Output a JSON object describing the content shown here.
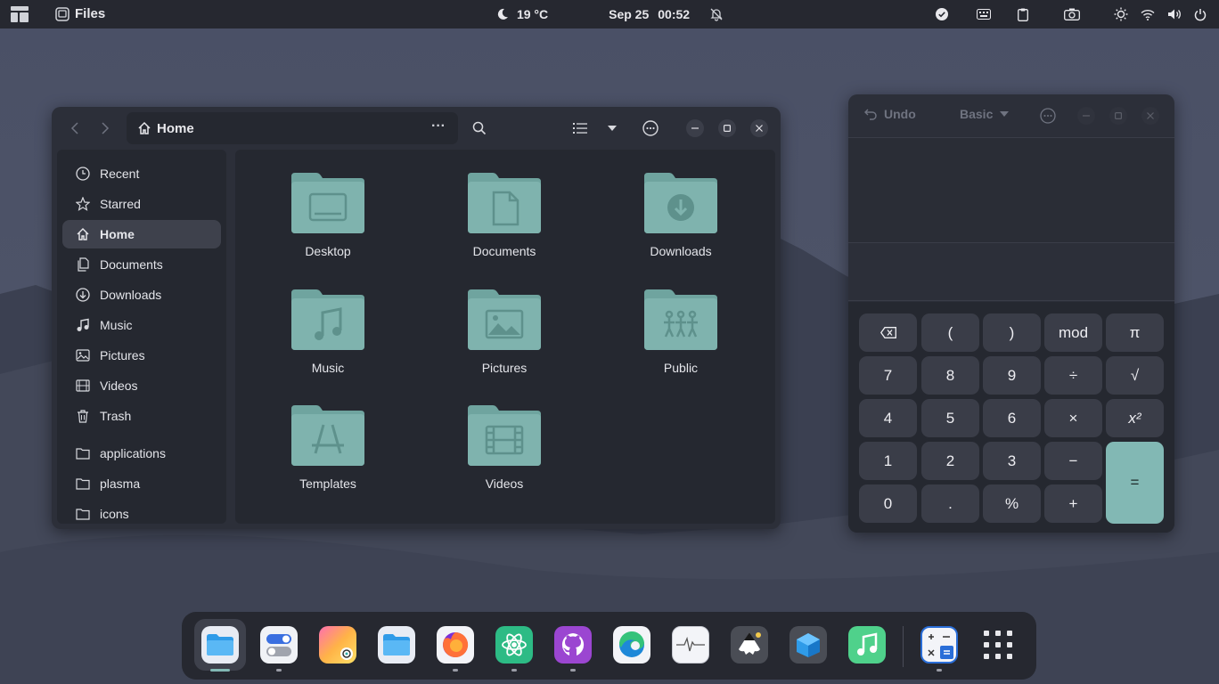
{
  "topbar": {
    "app_name": "Files",
    "weather": "19 °C",
    "date": "Sep 25",
    "time": "00:52"
  },
  "files": {
    "path": "Home",
    "sidebar": [
      {
        "label": "Recent",
        "icon": "clock-icon"
      },
      {
        "label": "Starred",
        "icon": "star-icon"
      },
      {
        "label": "Home",
        "icon": "home-icon",
        "active": true
      },
      {
        "label": "Documents",
        "icon": "documents-icon"
      },
      {
        "label": "Downloads",
        "icon": "download-icon"
      },
      {
        "label": "Music",
        "icon": "music-icon"
      },
      {
        "label": "Pictures",
        "icon": "pictures-icon"
      },
      {
        "label": "Videos",
        "icon": "videos-icon"
      },
      {
        "label": "Trash",
        "icon": "trash-icon"
      },
      {
        "label": "applications",
        "icon": "folder-icon"
      },
      {
        "label": "plasma",
        "icon": "folder-icon"
      },
      {
        "label": "icons",
        "icon": "folder-icon"
      }
    ],
    "folders": [
      "Desktop",
      "Documents",
      "Downloads",
      "Music",
      "Pictures",
      "Public",
      "Templates",
      "Videos"
    ]
  },
  "calculator": {
    "undo": "Undo",
    "mode": "Basic",
    "keys": {
      "lparen": "(",
      "rparen": ")",
      "mod": "mod",
      "pi": "π",
      "k7": "7",
      "k8": "8",
      "k9": "9",
      "div": "÷",
      "sqrt": "√",
      "k4": "4",
      "k5": "5",
      "k6": "6",
      "mul": "×",
      "sq": "x²",
      "k1": "1",
      "k2": "2",
      "k3": "3",
      "sub": "−",
      "k0": "0",
      "dot": ".",
      "pct": "%",
      "add": "+",
      "eq": "="
    }
  },
  "colors": {
    "accent": "#82b8b4",
    "folder": "#7fb3ae",
    "panel": "#262830",
    "window": "#2c2f39"
  }
}
